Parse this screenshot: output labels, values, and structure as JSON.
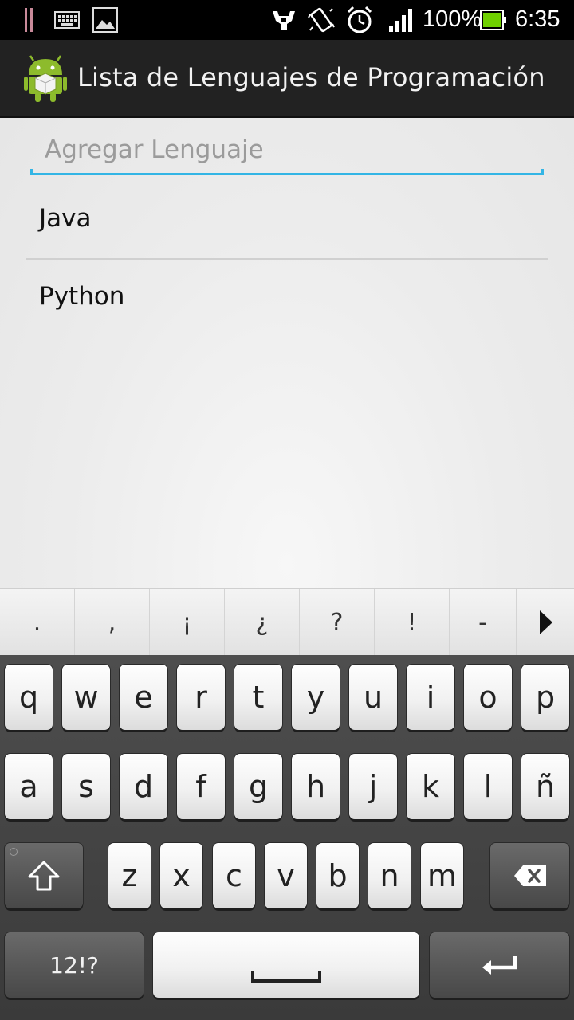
{
  "status_bar": {
    "left_icons": [
      "notification-bars-icon",
      "keyboard-icon",
      "image-icon"
    ],
    "right_icons": [
      "usb-debug-icon",
      "vibrate-icon",
      "alarm-icon",
      "signal-icon"
    ],
    "battery": "100%",
    "time": "6:35"
  },
  "action_bar": {
    "icon": "android-app-icon",
    "title": "Lista de Lenguajes de Programación"
  },
  "editor": {
    "placeholder": "Agregar Lenguaje",
    "value": ""
  },
  "languages": [
    {
      "label": "Java"
    },
    {
      "label": "Python"
    }
  ],
  "suggestions": [
    ".",
    ",",
    "¡",
    "¿",
    "?",
    "!",
    "-"
  ],
  "keyboard": {
    "row1": [
      "q",
      "w",
      "e",
      "r",
      "t",
      "y",
      "u",
      "i",
      "o",
      "p"
    ],
    "row2": [
      "a",
      "s",
      "d",
      "f",
      "g",
      "h",
      "j",
      "k",
      "l",
      "ñ"
    ],
    "row3": [
      "z",
      "x",
      "c",
      "v",
      "b",
      "n",
      "m"
    ],
    "symbols_label": "12!?",
    "shift_icon": "shift-icon",
    "delete_icon": "backspace-icon",
    "space_icon": "space-icon",
    "enter_icon": "enter-icon"
  },
  "colors": {
    "accent": "#33b5e5",
    "action_bar": "#222222",
    "status_bar": "#000000",
    "battery": "#6fd000"
  }
}
